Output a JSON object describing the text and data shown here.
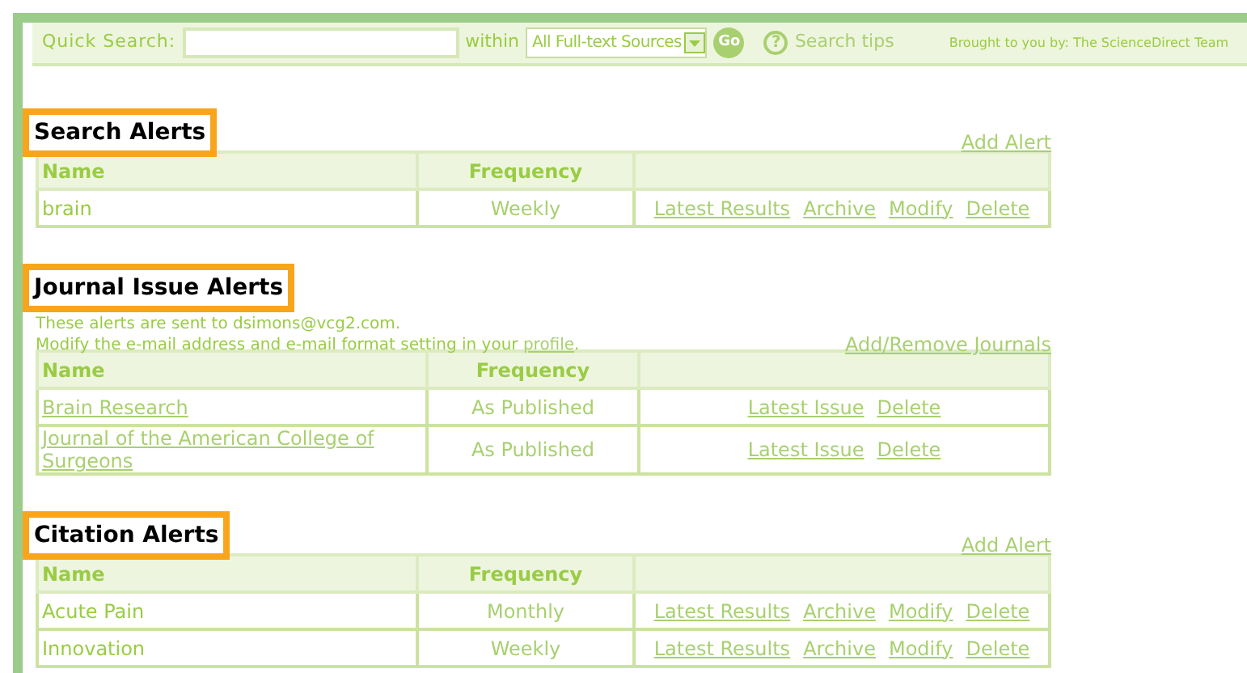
{
  "search_bar": {
    "label": "Quick Search:",
    "within_label": "within",
    "source_select": "All Full-text Sources",
    "go_button": "Go",
    "help_glyph": "?",
    "tips_link": "Search tips",
    "credit": "Brought to you by: The ScienceDirect Team"
  },
  "sections": [
    {
      "title": "Search Alerts",
      "action_link": "Add Alert",
      "columns": [
        "Name",
        "Frequency"
      ],
      "rows": [
        {
          "kind": "text",
          "name": "brain",
          "frequency": "Weekly",
          "actions": [
            "Latest Results",
            "Archive",
            "Modify",
            "Delete"
          ]
        }
      ]
    },
    {
      "title": "Journal Issue Alerts",
      "note": {
        "sent_to": "These alerts are sent to dsimons@vcg2.com.",
        "modify_text": "Modify the e-mail address and e-mail format setting in your",
        "modify_link": "profile",
        "modify_end": "."
      },
      "action_link": "Add/Remove Journals",
      "columns": [
        "Name",
        "Frequency"
      ],
      "rows": [
        {
          "kind": "link",
          "name": "Brain Research",
          "frequency": "As Published",
          "actions": [
            "Latest Issue",
            "Delete"
          ]
        },
        {
          "kind": "link",
          "name": "Journal of the American College of Surgeons",
          "frequency": "As Published",
          "actions": [
            "Latest Issue",
            "Delete"
          ]
        }
      ]
    },
    {
      "title": "Citation Alerts",
      "action_link": "Add Alert",
      "columns": [
        "Name",
        "Frequency"
      ],
      "rows": [
        {
          "kind": "text",
          "name": "Acute Pain",
          "frequency": "Monthly",
          "actions": [
            "Latest Results",
            "Archive",
            "Modify",
            "Delete"
          ]
        },
        {
          "kind": "text",
          "name": "Innovation",
          "frequency": "Weekly",
          "actions": [
            "Latest Results",
            "Archive",
            "Modify",
            "Delete"
          ]
        }
      ]
    }
  ]
}
